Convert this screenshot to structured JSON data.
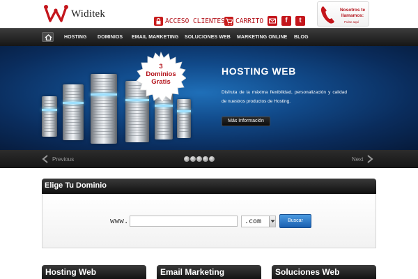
{
  "header": {
    "brand": "Widitek",
    "links": {
      "acceso": "ACCESO CLIENTES",
      "carrito": "CARRITO"
    },
    "social": {
      "mail": "mail-icon",
      "facebook": "f",
      "twitter": "t"
    },
    "callback": {
      "title": "Nosotros te llamamos:",
      "subtitle": "Pulse aquí"
    }
  },
  "nav": {
    "items": [
      "HOSTING",
      "DOMINIOS",
      "EMAIL MARKETING",
      "SOLUCIONES WEB",
      "MARKETING ONLINE",
      "BLOG"
    ]
  },
  "hero": {
    "badge": [
      "3",
      "Dominios",
      "Gratis"
    ],
    "title": "HOSTING WEB",
    "description": "Disfruta de la máxima flexibilidad, personalización y calidad de nuestros productos de Hosting.",
    "button": "Más Información"
  },
  "slider": {
    "prev": "Previous",
    "next": "Next",
    "dot_count": 5
  },
  "domain": {
    "title": "Elige Tu Dominio",
    "prefix": "www.",
    "input_value": "",
    "tld": ".com",
    "search_button": "Buscar"
  },
  "sections": {
    "hosting": "Hosting Web",
    "email": "Email Marketing",
    "soluciones": "Soluciones Web"
  },
  "colors": {
    "brand_red": "#c4161c",
    "nav_dark": "#161616",
    "hero_blue": "#114a8a",
    "button_blue": "#1a5fb0"
  }
}
